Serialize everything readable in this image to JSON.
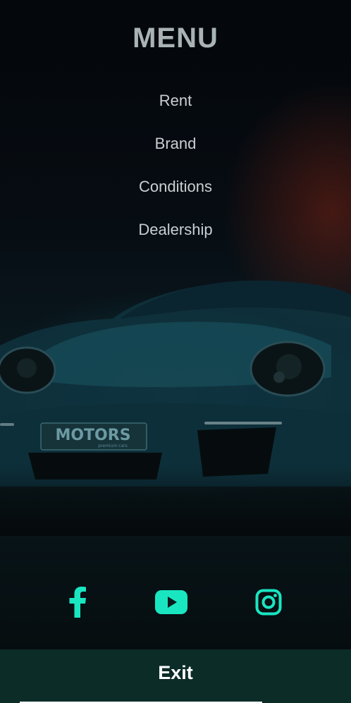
{
  "menu": {
    "title": "MENU",
    "items": [
      {
        "label": "Rent"
      },
      {
        "label": "Brand"
      },
      {
        "label": "Conditions"
      },
      {
        "label": "Dealership"
      }
    ]
  },
  "background": {
    "plate_text": "MOTORS",
    "plate_subtext": "premium cars"
  },
  "socials": [
    {
      "icon": "facebook-icon"
    },
    {
      "icon": "youtube-icon"
    },
    {
      "icon": "instagram-icon"
    }
  ],
  "footer": {
    "exit_label": "Exit"
  },
  "colors": {
    "accent": "#19e6c1",
    "exit_bar": "#0c2c28",
    "menu_text": "#c9d0d2",
    "title_text": "#a9b3b6"
  }
}
